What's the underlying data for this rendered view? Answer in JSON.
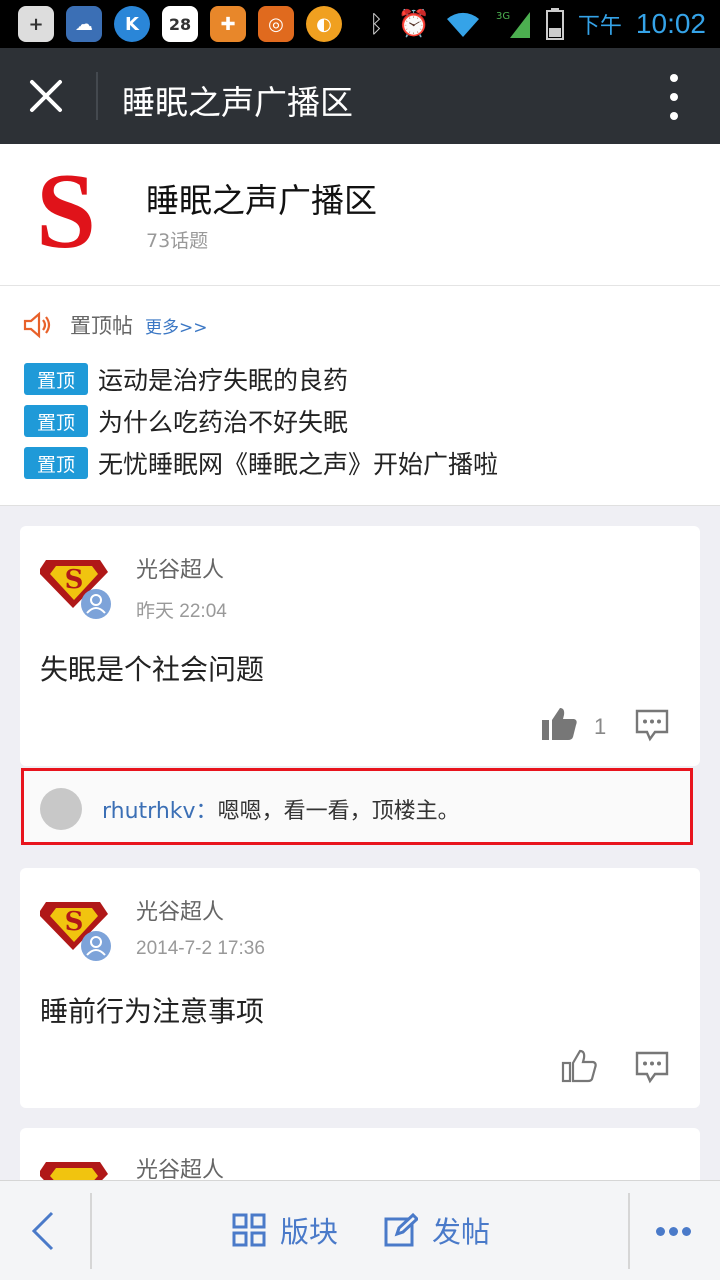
{
  "status_bar": {
    "calendar_day": "28",
    "ampm": "下午",
    "time": "10:02",
    "network": "3G"
  },
  "titlebar": {
    "title": "睡眠之声广播区"
  },
  "forum": {
    "logo_letter": "S",
    "title": "睡眠之声广播区",
    "topic_count": "73话题"
  },
  "pinned": {
    "label": "置顶帖",
    "more": "更多>>",
    "tag": "置顶",
    "items": [
      "运动是治疗失眠的良药",
      "为什么吃药治不好失眠",
      "无忧睡眠网《睡眠之声》开始广播啦"
    ]
  },
  "posts": [
    {
      "author": "光谷超人",
      "time": "昨天 22:04",
      "title": "失眠是个社会问题",
      "likes": "1",
      "reply": {
        "user": "rhutrhkv",
        "sep": "：",
        "text": "嗯嗯，看一看，顶楼主。"
      }
    },
    {
      "author": "光谷超人",
      "time": "2014-7-2 17:36",
      "title": "睡前行为注意事项"
    },
    {
      "author": "光谷超人"
    }
  ],
  "bottom": {
    "sections_label": "版块",
    "post_label": "发帖"
  },
  "colors": {
    "accent": "#1f9ad8",
    "link": "#3b6fb5",
    "highlight_border": "#e8141d",
    "titlebar": "#2d3136"
  }
}
